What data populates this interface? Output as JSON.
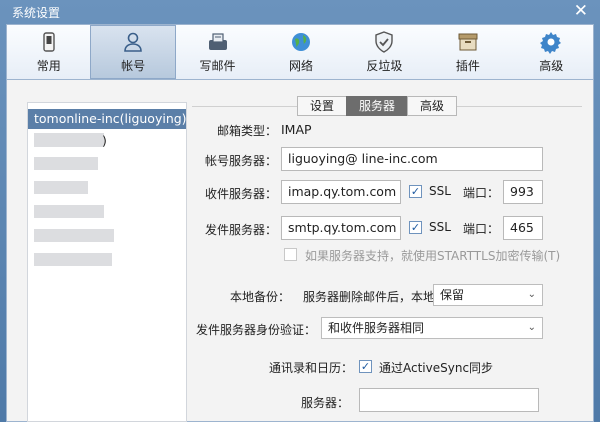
{
  "window": {
    "title": "系统设置",
    "close_glyph": "✕"
  },
  "toolbar": {
    "items": [
      {
        "label": "常用",
        "icon": "phone-icon"
      },
      {
        "label": "帐号",
        "icon": "user-icon",
        "active": true
      },
      {
        "label": "写邮件",
        "icon": "compose-icon"
      },
      {
        "label": "网络",
        "icon": "globe-icon"
      },
      {
        "label": "反垃圾",
        "icon": "shield-icon"
      },
      {
        "label": "插件",
        "icon": "plugin-box-icon"
      },
      {
        "label": "高级",
        "icon": "gear-icon"
      }
    ]
  },
  "accounts": {
    "selected": "tomonline-inc(liguoying)",
    "partial": ")"
  },
  "tabs": [
    "设置",
    "服务器",
    "高级"
  ],
  "active_tab": "服务器",
  "server": {
    "mailbox_type_label": "邮箱类型：",
    "mailbox_type_value": "IMAP",
    "account_server_label": "帐号服务器：",
    "account_server_value": "liguoying@              line-inc.com",
    "incoming_label": "收件服务器：",
    "incoming_value": "imap.qy.tom.com",
    "ssl_label": "SSL",
    "port_label": "端口：",
    "incoming_port": "993",
    "outgoing_label": "发件服务器：",
    "outgoing_value": "smtp.qy.tom.com",
    "outgoing_port": "465",
    "starttls_label": "如果服务器支持，就使用STARTTLS加密传输(T)",
    "backup_label": "本地备份：",
    "backup_desc": "服务器删除邮件后，本地",
    "backup_option": "保留",
    "auth_label": "发件服务器身份验证：",
    "auth_option": "和收件服务器相同",
    "contacts_label": "通讯录和日历：",
    "activesync_label": "通过ActiveSync同步",
    "server_label": "服务器：",
    "server_value": ""
  }
}
